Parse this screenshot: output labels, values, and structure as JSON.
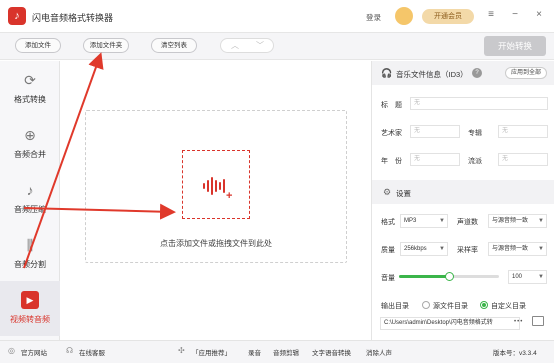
{
  "app": {
    "title": "闪电音频格式转换器",
    "login": "登录",
    "vip": "开通会员"
  },
  "window_controls": [
    "≡",
    "−",
    "×"
  ],
  "toolbar": {
    "add_file": "添加文件",
    "add_folder": "添加文件夹",
    "clear_list": "清空列表",
    "up": "︿",
    "down": "﹀",
    "start": "开始转换"
  },
  "sidebar": {
    "items": [
      {
        "label": "格式转换",
        "icon": "format-convert-icon",
        "glyph": "⟳"
      },
      {
        "label": "音频合并",
        "icon": "audio-merge-icon",
        "glyph": "⊕"
      },
      {
        "label": "音频压缩",
        "icon": "audio-compress-icon",
        "glyph": "♪"
      },
      {
        "label": "音频分割",
        "icon": "audio-split-icon",
        "glyph": "⫼"
      },
      {
        "label": "视频转音频",
        "icon": "video-to-audio-icon",
        "glyph": "▶"
      }
    ]
  },
  "drop": {
    "text": "点击添加文件或拖拽文件到此处",
    "plus": "+"
  },
  "id3": {
    "title": "音乐文件信息（ID3）",
    "help": "?",
    "apply_all": "应用到全部",
    "title_label": "标　题",
    "artist_label": "艺术家",
    "album_label": "专辑",
    "year_label": "年　份",
    "genre_label": "流派",
    "placeholder": "无"
  },
  "settings": {
    "title": "设置",
    "format_label": "格式",
    "format_value": "MP3",
    "channels_label": "声道数",
    "channels_value": "与源音频一致",
    "quality_label": "质量",
    "quality_value": "256kbps",
    "samplerate_label": "采样率",
    "samplerate_value": "与源音频一致",
    "volume_label": "音量",
    "volume_value": "100",
    "volume_level": 0.5,
    "output_label": "输出目录",
    "source_dir": "源文件目录",
    "custom_dir": "自定义目录",
    "path": "C:\\Users\\admin\\Desktop\\闪电音频格式转",
    "more": "•••"
  },
  "status": {
    "website": "官方网站",
    "support": "在线客服",
    "recommend": "「应用推荐」",
    "links": [
      "录音",
      "音频剪辑",
      "文字语音转换",
      "消除人声"
    ],
    "version": "版本号：v3.3.4"
  },
  "colors": {
    "accent": "#d9342b",
    "green": "#3bb54a",
    "arrow": "#e0392b"
  }
}
